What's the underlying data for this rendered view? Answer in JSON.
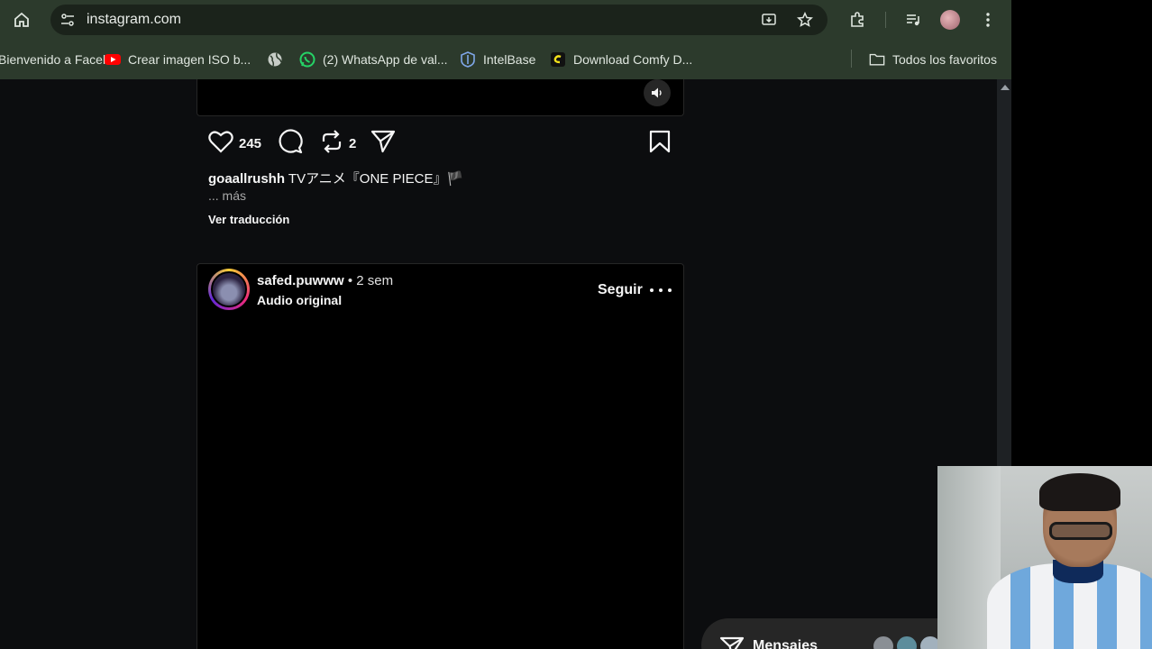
{
  "browser": {
    "url": "instagram.com",
    "bookmarks": [
      {
        "label": "Bienvenido a Faceb...",
        "icon": "facebook-icon"
      },
      {
        "label": "Crear imagen ISO b...",
        "icon": "youtube-icon"
      },
      {
        "label": "",
        "icon": "globe-icon"
      },
      {
        "label": "(2) WhatsApp de val...",
        "icon": "whatsapp-icon"
      },
      {
        "label": "IntelBase",
        "icon": "intelbase-icon"
      },
      {
        "label": "Download Comfy D...",
        "icon": "comfy-icon"
      }
    ],
    "all_bookmarks_label": "Todos los favoritos"
  },
  "post1": {
    "likes": "245",
    "reposts": "2",
    "caption_user": "goaallrushh",
    "caption_text": "TVアニメ『ONE PIECE』🏴",
    "more_label": "... más",
    "translate_label": "Ver traducción"
  },
  "post2": {
    "username": "safed.puwww",
    "time": "• 2 sem",
    "audio": "Audio original",
    "follow_label": "Seguir"
  },
  "messages": {
    "label": "Mensajes"
  },
  "colors": {
    "chrome_bg": "#2c3a2c",
    "page_bg": "#0c0d0f",
    "text": "#f5f5f5",
    "muted": "#a8a8a8"
  }
}
